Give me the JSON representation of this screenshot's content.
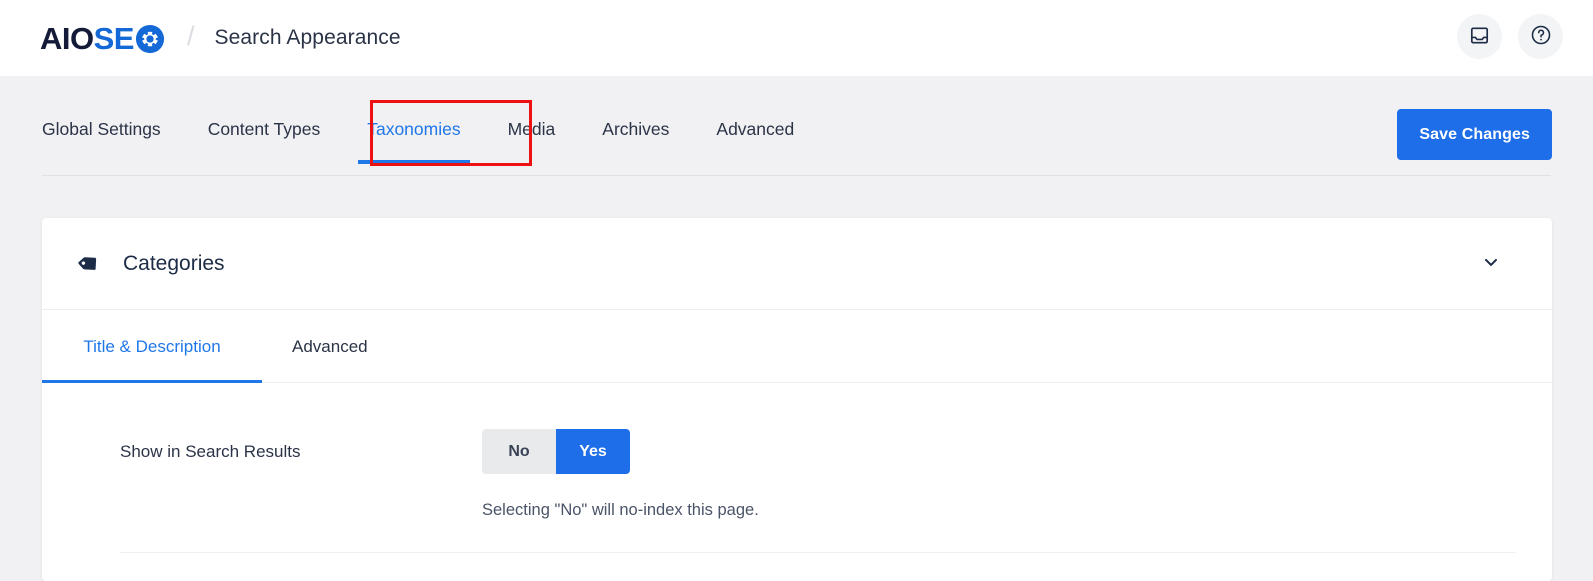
{
  "header": {
    "logo": {
      "part1": "AIO",
      "part2": "SE",
      "icon": "gear-icon"
    },
    "separator": "/",
    "page_title": "Search Appearance",
    "actions": [
      {
        "name": "inbox-icon",
        "label": "Notifications"
      },
      {
        "name": "help-icon",
        "label": "Help"
      }
    ]
  },
  "nav": {
    "tabs": [
      {
        "label": "Global Settings",
        "active": false
      },
      {
        "label": "Content Types",
        "active": false
      },
      {
        "label": "Taxonomies",
        "active": true
      },
      {
        "label": "Media",
        "active": false
      },
      {
        "label": "Archives",
        "active": false
      },
      {
        "label": "Advanced",
        "active": false
      }
    ],
    "save_label": "Save Changes",
    "annotation_color": "#ee1111",
    "accent_color": "#2077e8"
  },
  "card": {
    "title": "Categories",
    "icon": "tag-icon",
    "collapse_icon": "chevron-down-icon",
    "subtabs": [
      {
        "label": "Title & Description",
        "active": true
      },
      {
        "label": "Advanced",
        "active": false
      }
    ],
    "settings": [
      {
        "label": "Show in Search Results",
        "options": [
          {
            "label": "No",
            "selected": false
          },
          {
            "label": "Yes",
            "selected": true
          }
        ],
        "help": "Selecting \"No\" will no-index this page."
      }
    ]
  }
}
